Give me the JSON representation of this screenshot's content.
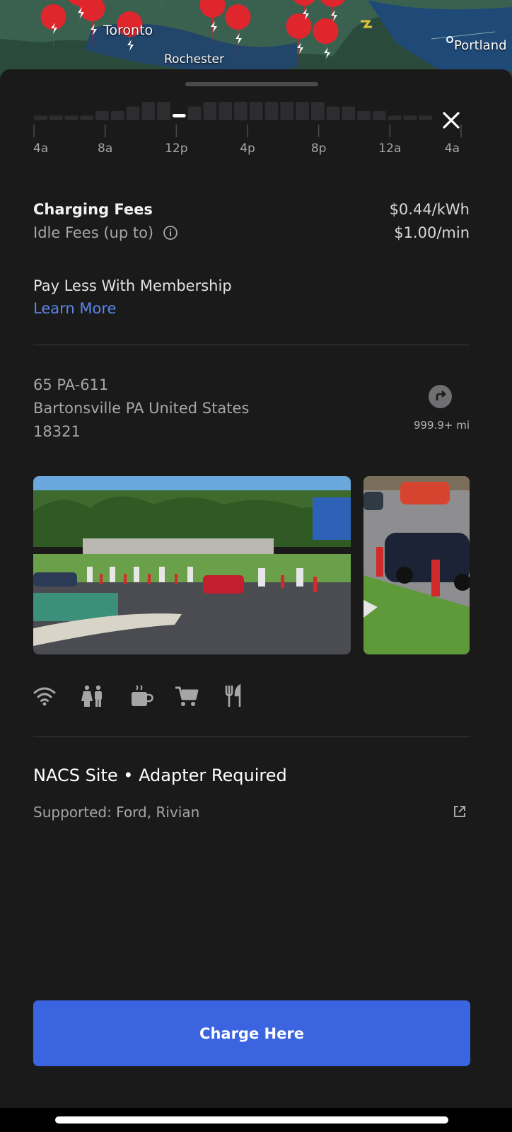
{
  "map": {
    "labels": [
      "Toronto",
      "Rochester",
      "Portland"
    ]
  },
  "chart_data": {
    "type": "bar",
    "title": "",
    "tick_labels": [
      "4a",
      "8a",
      "12p",
      "4p",
      "8p",
      "12a",
      "4a"
    ],
    "values": [
      1,
      1,
      1,
      1,
      2,
      2,
      3,
      4,
      4,
      3,
      3,
      4,
      4,
      4,
      4,
      4,
      4,
      4,
      4,
      3,
      3,
      2,
      2,
      1,
      1,
      1
    ],
    "current_index": 9,
    "grid": false
  },
  "fees": {
    "charging_label": "Charging Fees",
    "charging_value": "$0.44/kWh",
    "idle_label": "Idle Fees (up to)",
    "idle_value": "$1.00/min"
  },
  "membership": {
    "title": "Pay Less With Membership",
    "link": "Learn More"
  },
  "address": {
    "line1": "65 PA-611",
    "line2": "Bartonsville PA United States",
    "line3": "18321",
    "distance": "999.9+ mi"
  },
  "amenities": [
    "wifi-icon",
    "restroom-icon",
    "coffee-icon",
    "cart-icon",
    "utensils-icon"
  ],
  "site": {
    "title": "NACS Site • Adapter Required",
    "supported": "Supported: Ford, Rivian"
  },
  "cta": {
    "label": "Charge Here"
  },
  "colors": {
    "accent": "#3b64e0",
    "link": "#5b86e8",
    "pin": "#e0262d"
  }
}
